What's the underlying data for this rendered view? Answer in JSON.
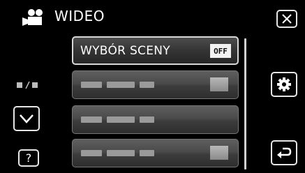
{
  "header": {
    "icon": "video-camera-icon",
    "title": "WIDEO"
  },
  "menu": {
    "items": [
      {
        "label": "WYBÓR SCENY",
        "value": "OFF",
        "active": true
      },
      {
        "label": "",
        "value": "",
        "active": false
      },
      {
        "label": "",
        "value": "",
        "active": false
      },
      {
        "label": "",
        "value": "",
        "active": false
      }
    ]
  },
  "controls": {
    "close_icon": "close-icon",
    "settings_icon": "gear-icon",
    "back_icon": "return-icon",
    "down_icon": "chevron-down-icon",
    "help_label": "?",
    "page_icon": "page-indicator-icon"
  },
  "colors": {
    "background": "#000000",
    "frame": "#e6e6e6",
    "badge": "#f2f2f2"
  }
}
